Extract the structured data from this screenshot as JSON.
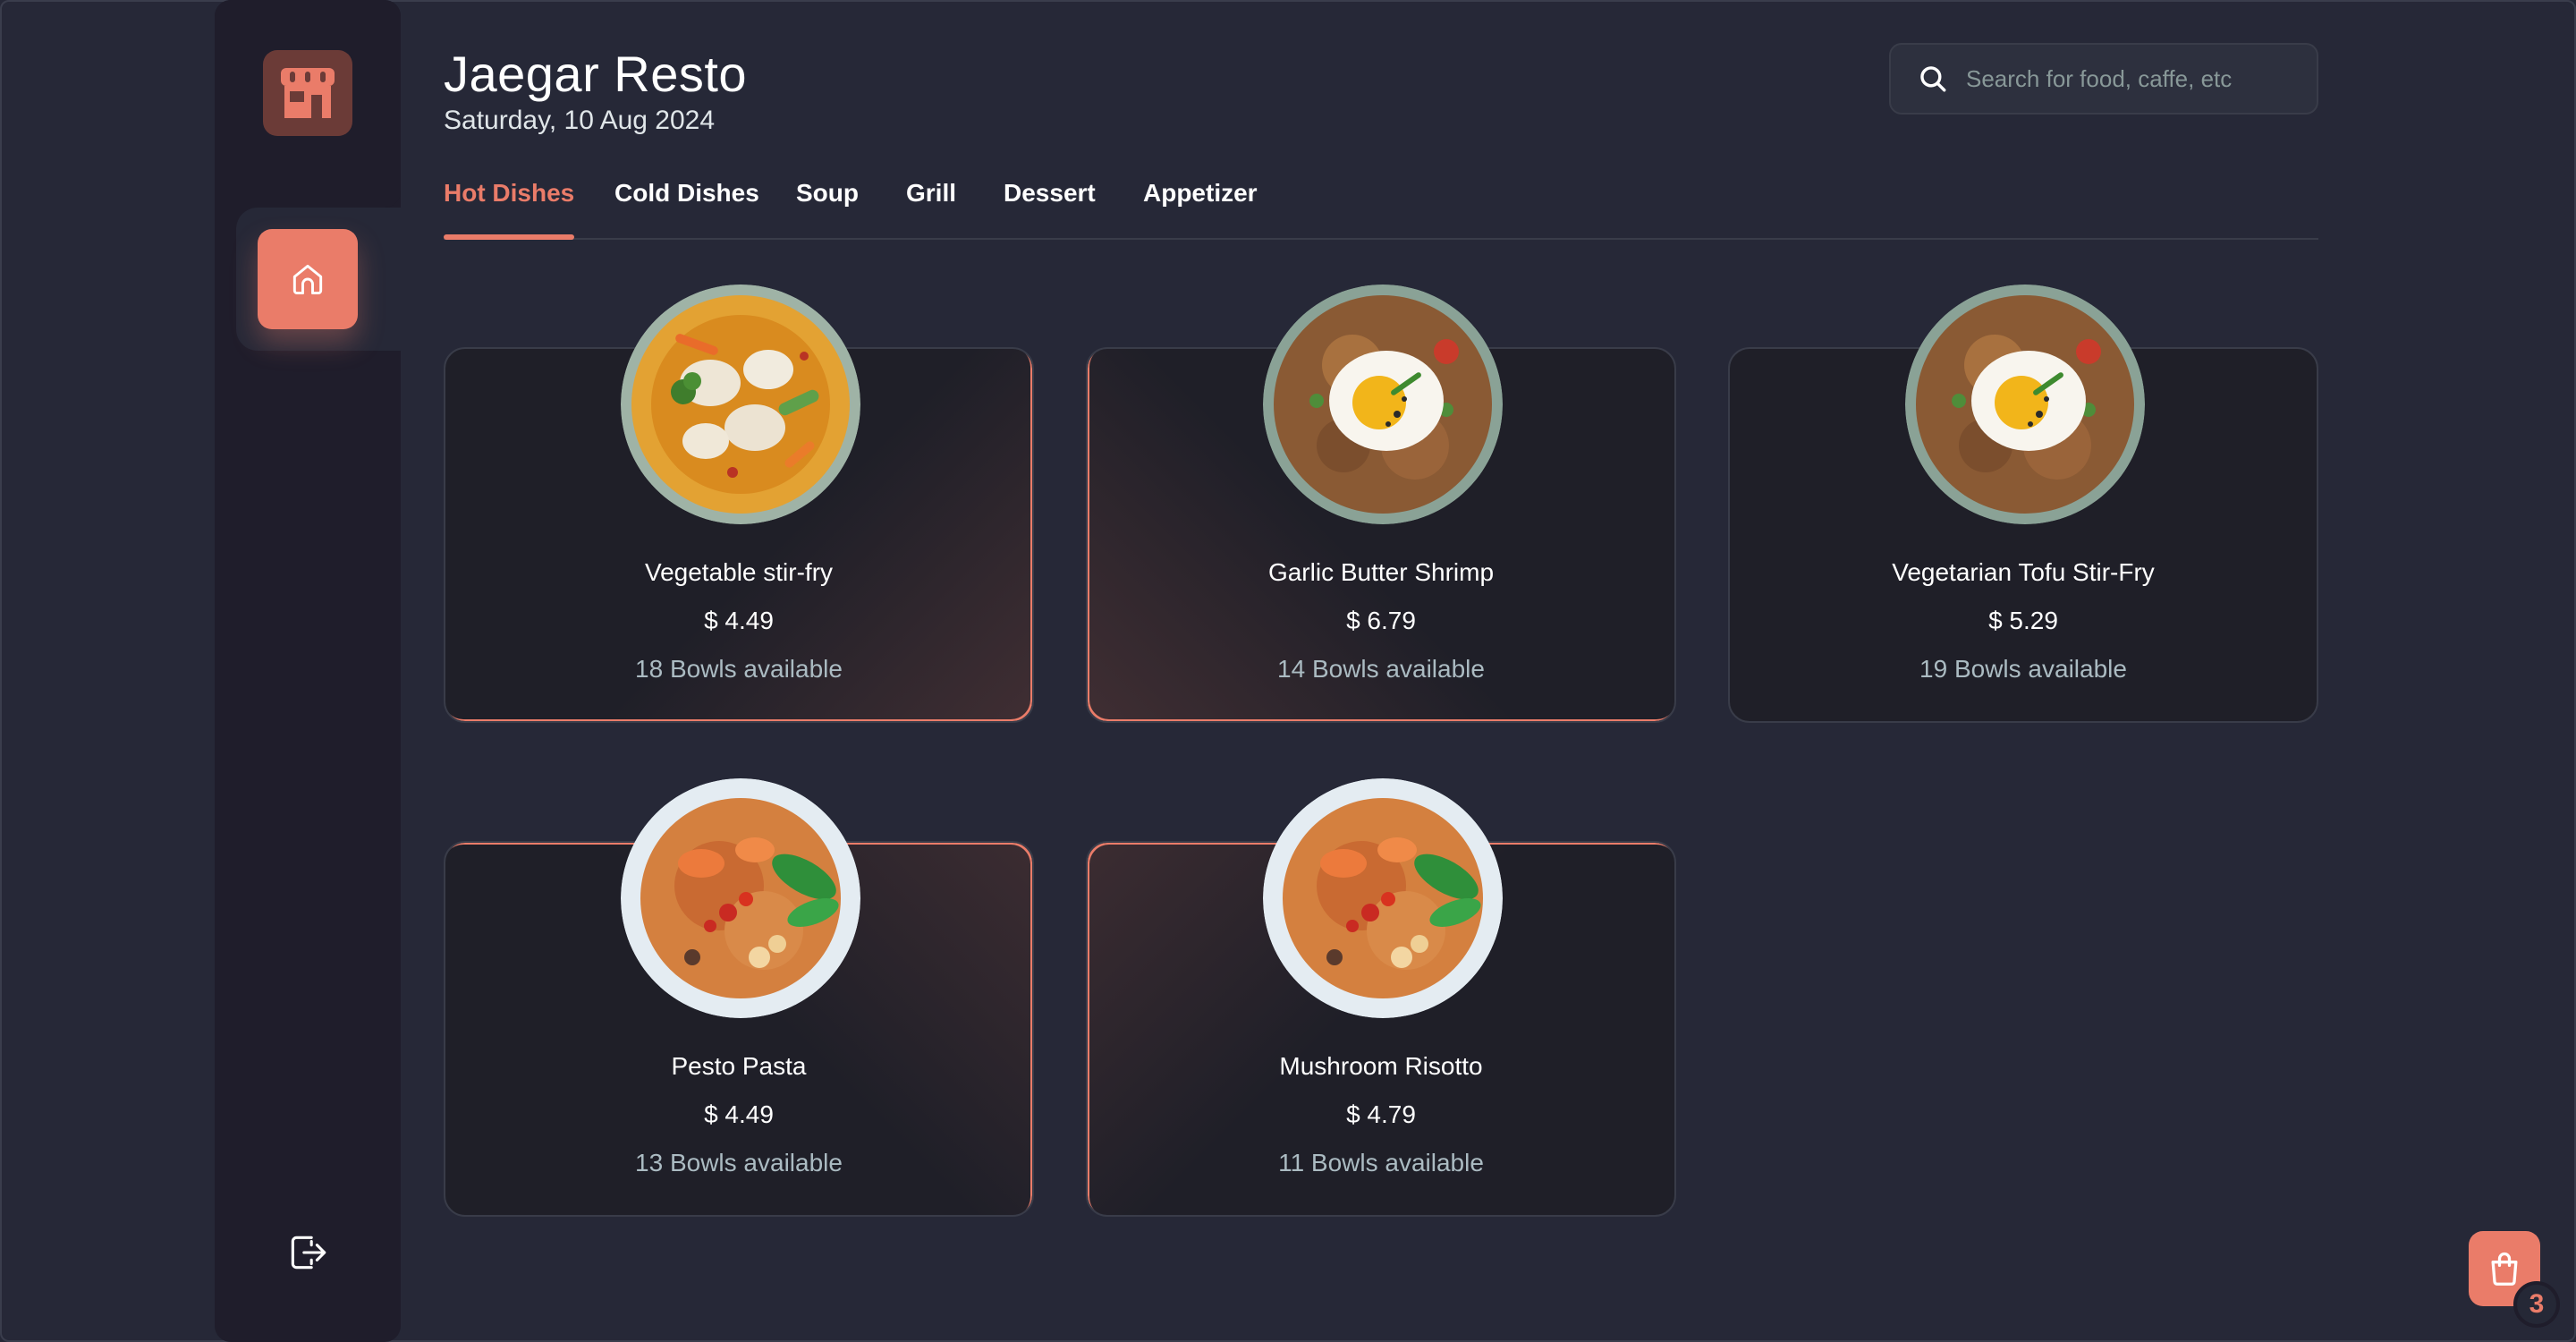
{
  "app": {
    "title": "Jaegar Resto",
    "date": "Saturday, 10 Aug 2024",
    "accent_color": "#ea7c69",
    "background_color": "#262837",
    "sidebar_color": "#1f1d2b"
  },
  "sidebar": {
    "logo_icon": "storefront-icon",
    "items": [
      {
        "name": "home",
        "icon": "home-icon",
        "active": true
      }
    ],
    "logout_icon": "logout-icon"
  },
  "search": {
    "placeholder": "Search for food, caffe, etc",
    "value": "",
    "icon": "search-icon"
  },
  "tabs": [
    {
      "label": "Hot Dishes",
      "active": true
    },
    {
      "label": "Cold Dishes",
      "active": false
    },
    {
      "label": "Soup",
      "active": false
    },
    {
      "label": "Grill",
      "active": false
    },
    {
      "label": "Dessert",
      "active": false
    },
    {
      "label": "Appetizer",
      "active": false
    }
  ],
  "dishes": [
    {
      "name": "Vegetable stir-fry",
      "price": "$ 4.49",
      "availability": "18 Bowls available",
      "image": "curry-dumplings"
    },
    {
      "name": "Garlic Butter Shrimp",
      "price": "$ 6.79",
      "availability": "14 Bowls available",
      "image": "fried-rice-egg"
    },
    {
      "name": "Vegetarian Tofu Stir-Fry",
      "price": "$ 5.29",
      "availability": "19 Bowls available",
      "image": "fried-rice-egg"
    },
    {
      "name": "Pesto Pasta",
      "price": "$ 4.49",
      "availability": "13 Bowls available",
      "image": "noodle-soup"
    },
    {
      "name": "Mushroom Risotto",
      "price": "$ 4.79",
      "availability": "11 Bowls available",
      "image": "noodle-soup"
    }
  ],
  "cart": {
    "icon": "shopping-bag-icon",
    "count": "3"
  }
}
